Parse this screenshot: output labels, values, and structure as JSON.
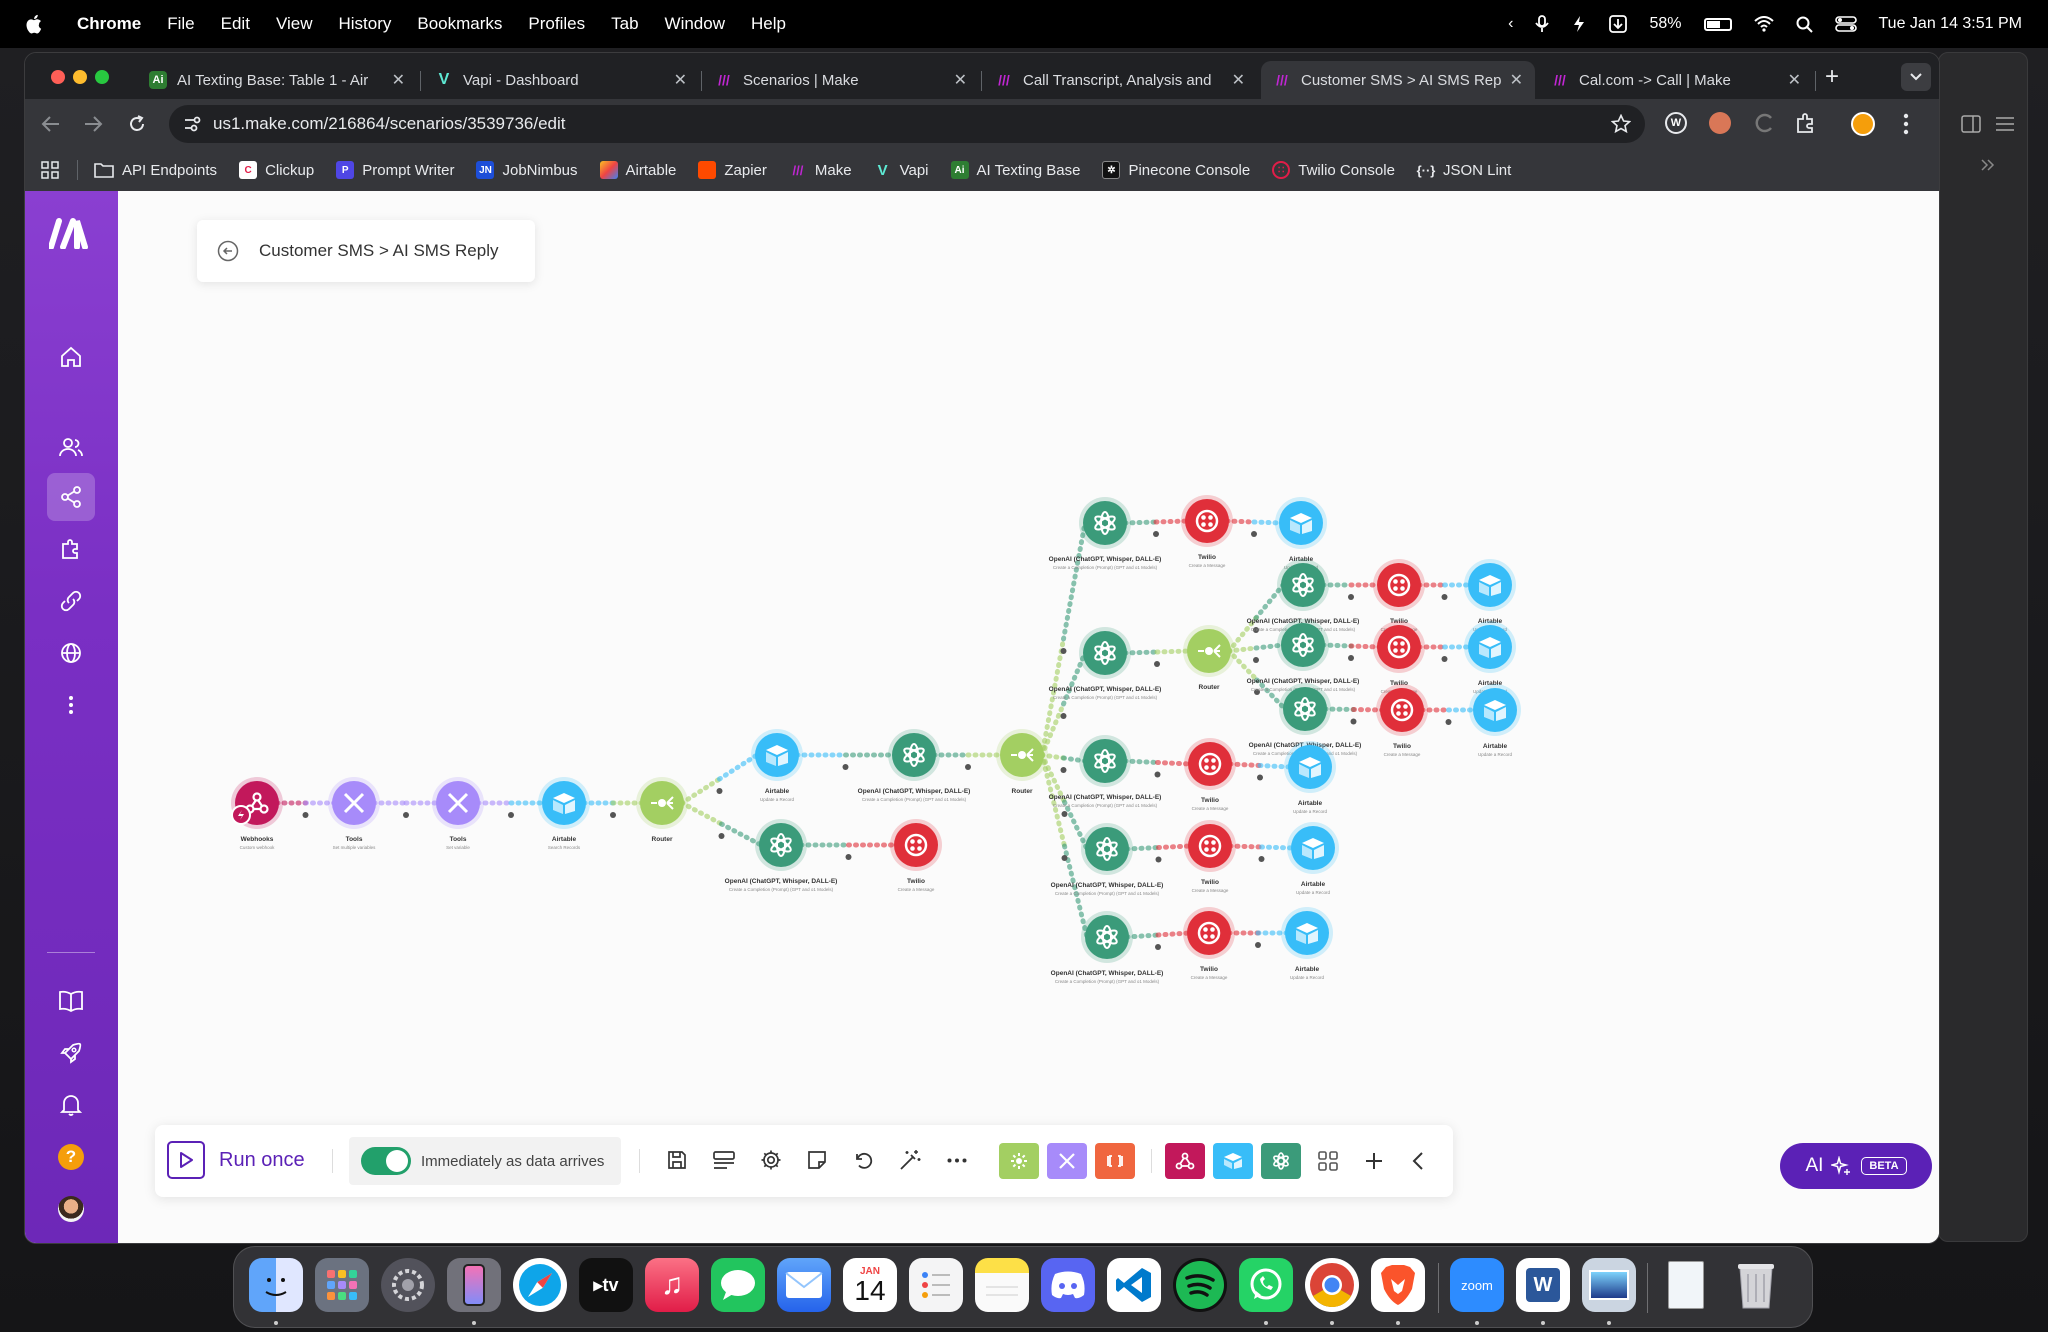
{
  "menubar": {
    "app_name": "Chrome",
    "items": [
      "File",
      "Edit",
      "View",
      "History",
      "Bookmarks",
      "Profiles",
      "Tab",
      "Window",
      "Help"
    ],
    "battery": "58%",
    "datetime": "Tue Jan 14  3:51 PM"
  },
  "tabs": [
    {
      "label": "AI Texting Base: Table 1 - Air",
      "icon": "airtable-ai-icon",
      "color": "#2e7d32"
    },
    {
      "label": "Vapi - Dashboard",
      "icon": "vapi-icon",
      "color": "#5eead4"
    },
    {
      "label": "Scenarios | Make",
      "icon": "make-icon",
      "color": "#c026d3"
    },
    {
      "label": "Call Transcript, Analysis and",
      "icon": "make-icon",
      "color": "#c026d3"
    },
    {
      "label": "Customer SMS > AI SMS Rep",
      "icon": "make-icon",
      "color": "#c026d3",
      "active": true
    },
    {
      "label": "Cal.com -> Call | Make",
      "icon": "make-icon",
      "color": "#c026d3"
    }
  ],
  "address_bar": {
    "url": "us1.make.com/216864/scenarios/3539736/edit"
  },
  "bookmarks": [
    {
      "label": "API Endpoints",
      "icon": "folder-icon",
      "color": "#9aa0a6"
    },
    {
      "label": "Clickup",
      "icon": "clickup-icon",
      "color": "#e11d48"
    },
    {
      "label": "Prompt Writer",
      "icon": "prompt-writer-icon",
      "color": "#4f46e5"
    },
    {
      "label": "JobNimbus",
      "icon": "jobnimbus-icon",
      "color": "#1d4ed8"
    },
    {
      "label": "Airtable",
      "icon": "airtable-icon",
      "color": "#f59e0b"
    },
    {
      "label": "Zapier",
      "icon": "zapier-icon",
      "color": "#ff4a00"
    },
    {
      "label": "Make",
      "icon": "make-icon",
      "color": "#c026d3"
    },
    {
      "label": "Vapi",
      "icon": "vapi-icon",
      "color": "#5eead4"
    },
    {
      "label": "AI Texting Base",
      "icon": "ai-texting-icon",
      "color": "#2e7d32"
    },
    {
      "label": "Pinecone Console",
      "icon": "pinecone-icon",
      "color": "#444444"
    },
    {
      "label": "Twilio Console",
      "icon": "twilio-icon",
      "color": "#e11d48"
    },
    {
      "label": "JSON Lint",
      "icon": "json-icon",
      "color": "#9aa0a6"
    }
  ],
  "scenario": {
    "title": "Customer SMS > AI SMS Reply"
  },
  "modules": [
    {
      "id": "webhooks",
      "name": "Webhooks",
      "sub": "Custom webhook",
      "color": "#c2185b",
      "icon": "webhook-icon"
    },
    {
      "id": "tools1",
      "name": "Tools",
      "sub": "Set multiple variables",
      "color": "#a78bfa",
      "icon": "tools-icon"
    },
    {
      "id": "tools2",
      "name": "Tools",
      "sub": "Set variable",
      "color": "#a78bfa",
      "icon": "tools-icon"
    },
    {
      "id": "airtable1",
      "name": "Airtable",
      "sub": "Search Records",
      "color": "#38bdf8",
      "icon": "airtable-icon"
    },
    {
      "id": "router1",
      "name": "Router",
      "sub": "",
      "color": "#a3cf62",
      "icon": "router-icon"
    },
    {
      "id": "airtable2",
      "name": "Airtable",
      "sub": "Update a Record",
      "color": "#38bdf8",
      "icon": "airtable-icon"
    },
    {
      "id": "openai1",
      "name": "OpenAI (ChatGPT, Whisper, DALL-E)",
      "sub": "Create a Completion (Prompt) (GPT and o1 Models)",
      "color": "#3b9b7a",
      "icon": "openai-icon"
    },
    {
      "id": "openai2",
      "name": "OpenAI (ChatGPT, Whisper, DALL-E)",
      "sub": "Create a Completion (Prompt) (GPT and o1 Models)",
      "color": "#3b9b7a",
      "icon": "openai-icon"
    },
    {
      "id": "twilio1",
      "name": "Twilio",
      "sub": "Create a Message",
      "color": "#e02f3a",
      "icon": "twilio-icon"
    },
    {
      "id": "router2",
      "name": "Router",
      "sub": "",
      "color": "#a3cf62",
      "icon": "router-icon"
    },
    {
      "id": "openai3",
      "name": "OpenAI (ChatGPT, Whisper, DALL-E)",
      "sub": "Create a Completion (Prompt) (GPT and o1 Models)",
      "color": "#3b9b7a",
      "icon": "openai-icon"
    },
    {
      "id": "twilio2",
      "name": "Twilio",
      "sub": "Create a Message",
      "color": "#e02f3a",
      "icon": "twilio-icon"
    },
    {
      "id": "airtable3",
      "name": "Airtable",
      "sub": "Update a Record",
      "color": "#38bdf8",
      "icon": "airtable-icon"
    },
    {
      "id": "openai4",
      "name": "OpenAI (ChatGPT, Whisper, DALL-E)",
      "sub": "Create a Completion (Prompt) (GPT and o1 Models)",
      "color": "#3b9b7a",
      "icon": "openai-icon"
    },
    {
      "id": "router3",
      "name": "Router",
      "sub": "",
      "color": "#a3cf62",
      "icon": "router-icon"
    },
    {
      "id": "openai5",
      "name": "OpenAI (ChatGPT, Whisper, DALL-E)",
      "sub": "Create a Completion (Prompt) (GPT and o1 Models)",
      "color": "#3b9b7a",
      "icon": "openai-icon"
    },
    {
      "id": "twilio3",
      "name": "Twilio",
      "sub": "Create a Message",
      "color": "#e02f3a",
      "icon": "twilio-icon"
    },
    {
      "id": "airtable4",
      "name": "Airtable",
      "sub": "Update a Record",
      "color": "#38bdf8",
      "icon": "airtable-icon"
    },
    {
      "id": "openai6",
      "name": "OpenAI (ChatGPT, Whisper, DALL-E)",
      "sub": "Create a Completion (Prompt) (GPT and o1 Models)",
      "color": "#3b9b7a",
      "icon": "openai-icon"
    },
    {
      "id": "twilio4",
      "name": "Twilio",
      "sub": "Create a Message",
      "color": "#e02f3a",
      "icon": "twilio-icon"
    },
    {
      "id": "airtable5",
      "name": "Airtable",
      "sub": "Update a Record",
      "color": "#38bdf8",
      "icon": "airtable-icon"
    },
    {
      "id": "openai7",
      "name": "OpenAI (ChatGPT, Whisper, DALL-E)",
      "sub": "Create a Completion (Prompt) (GPT and o1 Models)",
      "color": "#3b9b7a",
      "icon": "openai-icon"
    },
    {
      "id": "twilio5",
      "name": "Twilio",
      "sub": "Create a Message",
      "color": "#e02f3a",
      "icon": "twilio-icon"
    },
    {
      "id": "airtable6",
      "name": "Airtable",
      "sub": "Update a Record",
      "color": "#38bdf8",
      "icon": "airtable-icon"
    },
    {
      "id": "openai8",
      "name": "OpenAI (ChatGPT, Whisper, DALL-E)",
      "sub": "Create a Completion (Prompt) (GPT and o1 Models)",
      "color": "#3b9b7a",
      "icon": "openai-icon"
    },
    {
      "id": "twilio6",
      "name": "Twilio",
      "sub": "Create a Message",
      "color": "#e02f3a",
      "icon": "twilio-icon"
    },
    {
      "id": "airtable7",
      "name": "Airtable",
      "sub": "Update a Record",
      "color": "#38bdf8",
      "icon": "airtable-icon"
    },
    {
      "id": "openai9",
      "name": "OpenAI (ChatGPT, Whisper, DALL-E)",
      "sub": "Create a Completion (Prompt) (GPT and o1 Models)",
      "color": "#3b9b7a",
      "icon": "openai-icon"
    },
    {
      "id": "twilio7",
      "name": "Twilio",
      "sub": "Create a Message",
      "color": "#e02f3a",
      "icon": "twilio-icon"
    },
    {
      "id": "airtable8",
      "name": "Airtable",
      "sub": "Update a Record",
      "color": "#38bdf8",
      "icon": "airtable-icon"
    },
    {
      "id": "openai10",
      "name": "OpenAI (ChatGPT, Whisper, DALL-E)",
      "sub": "Create a Completion (Prompt) (GPT and o1 Models)",
      "color": "#3b9b7a",
      "icon": "openai-icon"
    },
    {
      "id": "twilio8",
      "name": "Twilio",
      "sub": "Create a Message",
      "color": "#e02f3a",
      "icon": "twilio-icon"
    },
    {
      "id": "airtable9",
      "name": "Airtable",
      "sub": "Update a Record",
      "color": "#38bdf8",
      "icon": "airtable-icon"
    }
  ],
  "connections": [
    [
      "webhooks",
      "tools1"
    ],
    [
      "tools1",
      "tools2"
    ],
    [
      "tools2",
      "airtable1"
    ],
    [
      "airtable1",
      "router1"
    ],
    [
      "router1",
      "airtable2"
    ],
    [
      "router1",
      "openai2"
    ],
    [
      "airtable2",
      "openai1"
    ],
    [
      "openai1",
      "router2"
    ],
    [
      "openai2",
      "twilio1"
    ],
    [
      "router2",
      "openai3"
    ],
    [
      "openai3",
      "twilio2"
    ],
    [
      "twilio2",
      "airtable3"
    ],
    [
      "router2",
      "openai4"
    ],
    [
      "openai4",
      "router3"
    ],
    [
      "router3",
      "openai5"
    ],
    [
      "openai5",
      "twilio3"
    ],
    [
      "twilio3",
      "airtable4"
    ],
    [
      "router3",
      "openai6"
    ],
    [
      "openai6",
      "twilio4"
    ],
    [
      "twilio4",
      "airtable5"
    ],
    [
      "router3",
      "openai7"
    ],
    [
      "openai7",
      "twilio5"
    ],
    [
      "twilio5",
      "airtable6"
    ],
    [
      "router2",
      "openai8"
    ],
    [
      "openai8",
      "twilio6"
    ],
    [
      "twilio6",
      "airtable7"
    ],
    [
      "router2",
      "openai9"
    ],
    [
      "openai9",
      "twilio7"
    ],
    [
      "twilio7",
      "airtable8"
    ],
    [
      "router2",
      "openai10"
    ],
    [
      "openai10",
      "twilio8"
    ],
    [
      "twilio8",
      "airtable9"
    ]
  ],
  "bottom_toolbar": {
    "run_label": "Run once",
    "schedule_label": "Immediately as data arrives",
    "schedule_enabled": true
  },
  "ai_button": {
    "label": "AI",
    "badge": "BETA"
  },
  "dock": [
    {
      "name": "Finder",
      "color": "#3b82f6"
    },
    {
      "name": "Launchpad",
      "color": "#6b7280"
    },
    {
      "name": "System Settings",
      "color": "#52525b"
    },
    {
      "name": "iPhone Mirroring",
      "color": "#71717a"
    },
    {
      "name": "Safari",
      "color": "#0ea5e9"
    },
    {
      "name": "Apple TV",
      "color": "#111111"
    },
    {
      "name": "Music",
      "color": "#f43f5e"
    },
    {
      "name": "Messages",
      "color": "#22c55e"
    },
    {
      "name": "Mail",
      "color": "#3b82f6"
    },
    {
      "name": "Calendar",
      "color": "#ffffff"
    },
    {
      "name": "Reminders",
      "color": "#f4f4f5"
    },
    {
      "name": "Notes",
      "color": "#facc15"
    },
    {
      "name": "Discord",
      "color": "#5865f2"
    },
    {
      "name": "VS Code",
      "color": "#007acc"
    },
    {
      "name": "Spotify",
      "color": "#1db954"
    },
    {
      "name": "WhatsApp",
      "color": "#25d366"
    },
    {
      "name": "Chrome",
      "color": "#ffffff"
    },
    {
      "name": "Brave",
      "color": "#fb542b"
    },
    {
      "name": "Zoom",
      "color": "#2d8cff"
    },
    {
      "name": "Word",
      "color": "#2b579a"
    },
    {
      "name": "Preview",
      "color": "#94a3b8"
    },
    {
      "name": "Downloads",
      "color": "#cbd5e1"
    },
    {
      "name": "Trash",
      "color": "#9ca3af"
    }
  ],
  "dock_labels": {
    "calendar_month": "JAN",
    "calendar_day": "14",
    "zoom": "zoom",
    "apple_tv": "tv"
  }
}
